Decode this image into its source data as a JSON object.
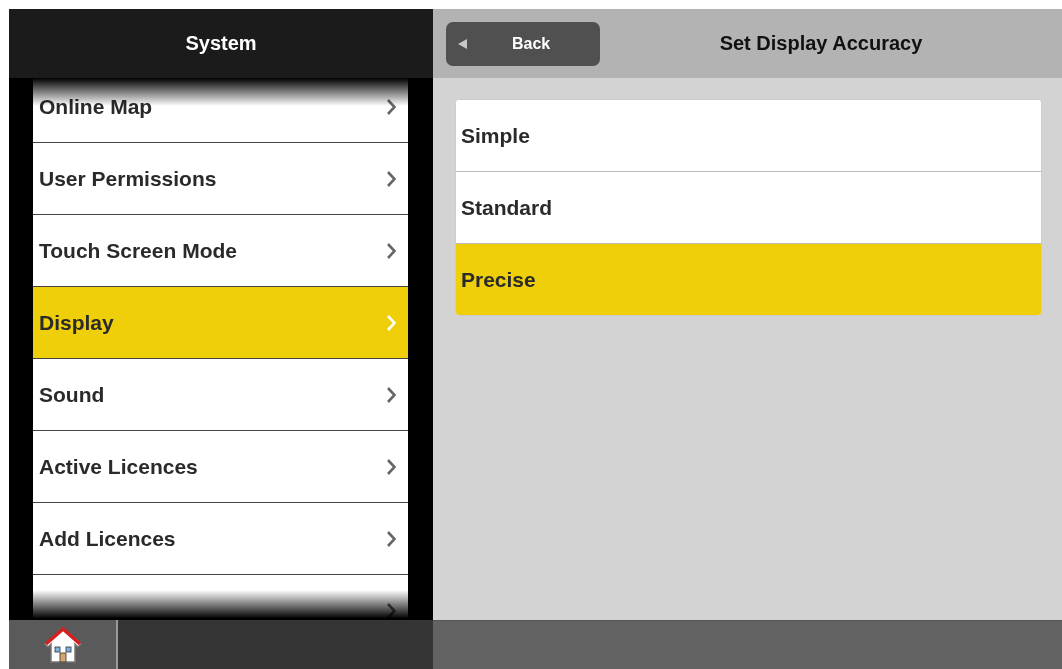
{
  "sidebar": {
    "title": "System",
    "items": [
      {
        "label": "Online Map",
        "selected": false
      },
      {
        "label": "User Permissions",
        "selected": false
      },
      {
        "label": "Touch Screen Mode",
        "selected": false
      },
      {
        "label": "Display",
        "selected": true
      },
      {
        "label": "Sound",
        "selected": false
      },
      {
        "label": "Active Licences",
        "selected": false
      },
      {
        "label": "Add Licences",
        "selected": false
      },
      {
        "selected": false
      }
    ]
  },
  "panel": {
    "back_button": "Back",
    "title": "Set Display Accuracy",
    "options": [
      {
        "label": "Simple",
        "selected": false
      },
      {
        "label": "Standard",
        "selected": false
      },
      {
        "label": "Precise",
        "selected": true
      }
    ]
  }
}
